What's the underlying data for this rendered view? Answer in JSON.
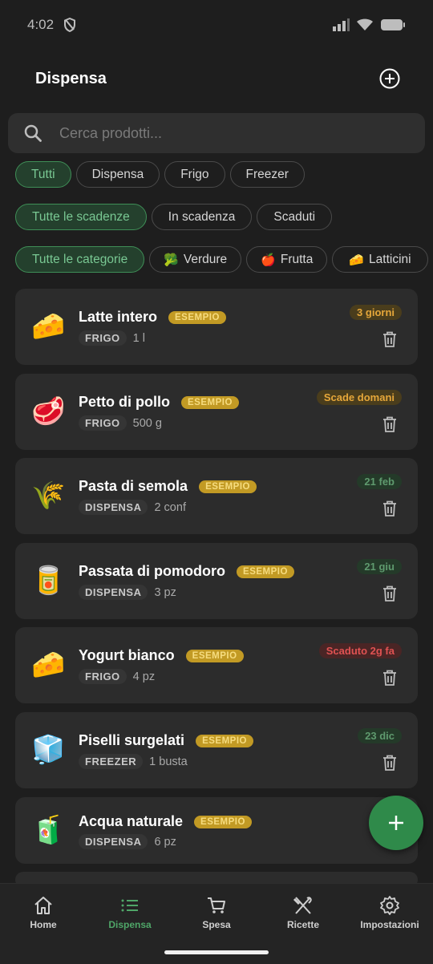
{
  "status": {
    "time": "4:02"
  },
  "header": {
    "title": "Dispensa"
  },
  "search": {
    "placeholder": "Cerca prodotti..."
  },
  "location_filters": [
    "Tutti",
    "Dispensa",
    "Frigo",
    "Freezer"
  ],
  "expiry_filters": [
    "Tutte le scadenze",
    "In scadenza",
    "Scaduti"
  ],
  "category_filters": [
    {
      "emoji": "",
      "label": "Tutte le categorie"
    },
    {
      "emoji": "🥦",
      "label": "Verdure"
    },
    {
      "emoji": "🍎",
      "label": "Frutta"
    },
    {
      "emoji": "🧀",
      "label": "Latticini"
    }
  ],
  "items": [
    {
      "emoji": "🧀",
      "name": "Latte intero",
      "tag": "ESEMPIO",
      "location": "FRIGO",
      "quantity": "1 l",
      "badge": "3 giorni",
      "badge_kind": "orange"
    },
    {
      "emoji": "🥩",
      "name": "Petto di pollo",
      "tag": "ESEMPIO",
      "location": "FRIGO",
      "quantity": "500 g",
      "badge": "Scade domani",
      "badge_kind": "orange"
    },
    {
      "emoji": "🌾",
      "name": "Pasta di semola",
      "tag": "ESEMPIO",
      "location": "DISPENSA",
      "quantity": "2 conf",
      "badge": "21 feb",
      "badge_kind": "green"
    },
    {
      "emoji": "🥫",
      "name": "Passata di pomodoro",
      "tag": "ESEMPIO",
      "location": "DISPENSA",
      "quantity": "3 pz",
      "badge": "21 giu",
      "badge_kind": "green"
    },
    {
      "emoji": "🧀",
      "name": "Yogurt bianco",
      "tag": "ESEMPIO",
      "location": "FRIGO",
      "quantity": "4 pz",
      "badge": "Scaduto 2g fa",
      "badge_kind": "red"
    },
    {
      "emoji": "🧊",
      "name": "Piselli surgelati",
      "tag": "ESEMPIO",
      "location": "FREEZER",
      "quantity": "1 busta",
      "badge": "23 dic",
      "badge_kind": "green"
    },
    {
      "emoji": "🧃",
      "name": "Acqua naturale",
      "tag": "ESEMPIO",
      "location": "DISPENSA",
      "quantity": "6 pz",
      "badge": "",
      "badge_kind": ""
    }
  ],
  "nav": [
    {
      "label": "Home",
      "icon": "home-icon"
    },
    {
      "label": "Dispensa",
      "icon": "list-icon"
    },
    {
      "label": "Spesa",
      "icon": "cart-icon"
    },
    {
      "label": "Ricette",
      "icon": "utensils-icon"
    },
    {
      "label": "Impostazioni",
      "icon": "gear-icon"
    }
  ],
  "colors": {
    "accent": "#2f8a4a",
    "background": "#1e1e1e",
    "card": "#2c2c2c"
  }
}
